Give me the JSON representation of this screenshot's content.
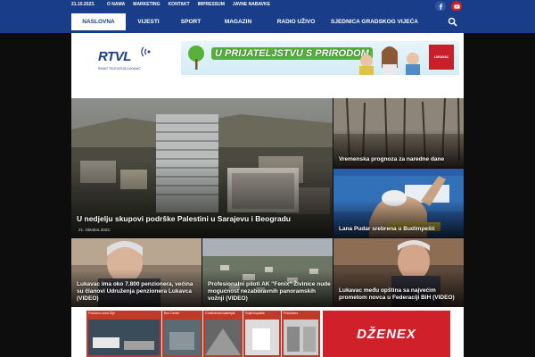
{
  "topbar": {
    "date": "21.10.2023.",
    "links": [
      "O NAMA",
      "MARKETING",
      "KONTAKT",
      "IMPRESSUM",
      "JAVNE NABAVKE"
    ]
  },
  "nav": {
    "items": [
      "NASLOVNA",
      "VIJESTI",
      "SPORT",
      "MAGAZIN",
      "RADIO UŽIVO",
      "SJEDNICA GRADSKOG VIJEĆA"
    ],
    "active": "NASLOVNA"
  },
  "logo": {
    "main": "RTVL",
    "sub": "RADIO TELEVIZIJA LUKAVAC"
  },
  "banner": {
    "text": "U PRIJATELJSTVU S PRIRODOM",
    "brand": "LUKAVAC"
  },
  "articles": {
    "main": {
      "title": "U nedjelju skupovi podrške Palestini u Sarajevu i Beogradu",
      "date": "21. Oktobra 2023."
    },
    "weather": {
      "title": "Vremenska prognoza za naredne dane"
    },
    "swim": {
      "title": "Lana Pudar srebrena u Budimpešti"
    },
    "pension": {
      "title": "Lukavac ima oko 7.800 penzionera, većina su članovi Udruženja penzionera Lukavca (VIDEO)"
    },
    "pilots": {
      "title": "Profesionalni piloti AK \"Fenix\" Živinice nude mogućnost nezaboravnih panoramskih vožnji (VIDEO)"
    },
    "invest": {
      "title": "Lukavac među opština sa najvećim prometom novca u Federaciji BiH (VIDEO)"
    }
  },
  "ads": {
    "left_captions": [
      "Poslovno zona Sije",
      "Box Center",
      "Građevinski materijali",
      "Svijet kupatila",
      "Pokućstvo"
    ],
    "right": "DŽENEX"
  },
  "colors": {
    "brand_blue": "#1a3d8a",
    "ad_red": "#d0202a"
  }
}
